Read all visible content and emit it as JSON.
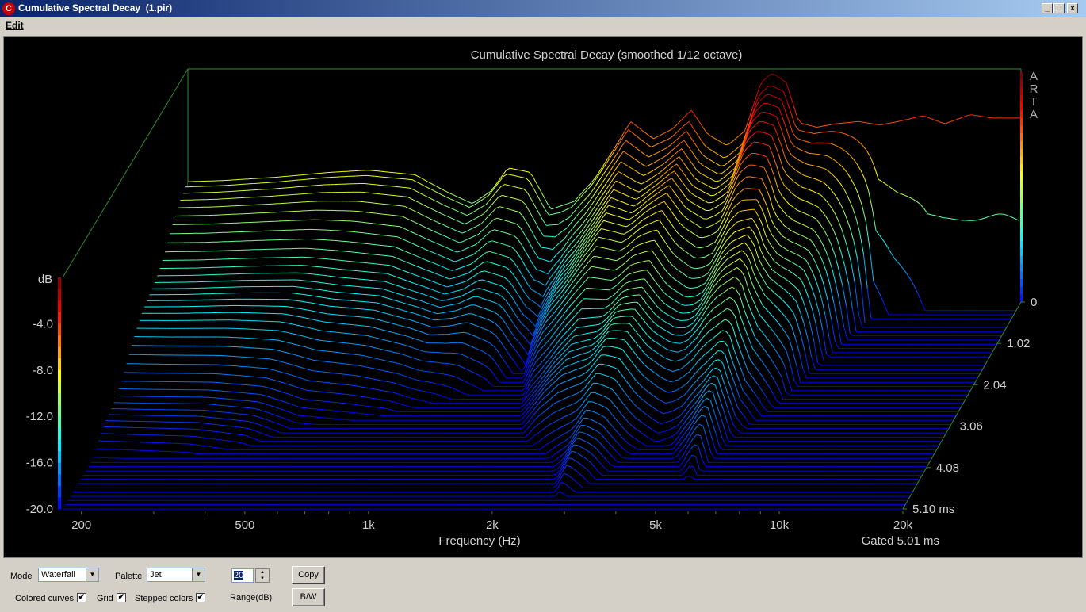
{
  "window": {
    "title": "Cumulative Spectral Decay  (1.pir)",
    "app_icon": "C",
    "min_glyph": "_",
    "max_glyph": "□",
    "close_glyph": "x"
  },
  "menu": {
    "edit": "Edit"
  },
  "chart_data": {
    "type": "waterfall",
    "title": "Cumulative Spectral Decay (smoothed 1/12 octave)",
    "watermark": [
      "A",
      "R",
      "T",
      "A"
    ],
    "xlabel": "Frequency (Hz)",
    "x_ticks": [
      {
        "label": "200",
        "value": 200
      },
      {
        "label": "500",
        "value": 500
      },
      {
        "label": "1k",
        "value": 1000
      },
      {
        "label": "2k",
        "value": 2000
      },
      {
        "label": "5k",
        "value": 5000
      },
      {
        "label": "10k",
        "value": 10000
      },
      {
        "label": "20k",
        "value": 20000
      }
    ],
    "xlim": [
      180,
      20000
    ],
    "x_scale": "log",
    "zlabel": "dB",
    "z_ticks": [
      "-4.0",
      "-8.0",
      "-12.0",
      "-16.0",
      "-20.0"
    ],
    "zlim": [
      -20,
      0
    ],
    "time_ticks": [
      "0",
      "1.02",
      "2.04",
      "3.06",
      "4.08",
      "5.10 ms"
    ],
    "time_range_ms": [
      0,
      5.1
    ],
    "slices": 50,
    "gated_label": "Gated 5.01 ms",
    "palette": "Jet",
    "frequency_response_db": [
      [
        180,
        -9.6
      ],
      [
        220,
        -9.5
      ],
      [
        300,
        -9.2
      ],
      [
        400,
        -8.8
      ],
      [
        500,
        -8.6
      ],
      [
        650,
        -9.0
      ],
      [
        780,
        -10.5
      ],
      [
        900,
        -11.5
      ],
      [
        1000,
        -10.4
      ],
      [
        1100,
        -8.4
      ],
      [
        1250,
        -8.8
      ],
      [
        1400,
        -12.0
      ],
      [
        1600,
        -11.3
      ],
      [
        1800,
        -9.3
      ],
      [
        2000,
        -6.8
      ],
      [
        2200,
        -4.4
      ],
      [
        2500,
        -5.9
      ],
      [
        2800,
        -5.0
      ],
      [
        3100,
        -3.4
      ],
      [
        3400,
        -5.5
      ],
      [
        3800,
        -6.5
      ],
      [
        4200,
        -5.2
      ],
      [
        4600,
        -1.0
      ],
      [
        4900,
        -0.2
      ],
      [
        5300,
        -1.0
      ],
      [
        5700,
        -4.5
      ],
      [
        6300,
        -4.9
      ],
      [
        7000,
        -4.6
      ],
      [
        8000,
        -4.4
      ],
      [
        9000,
        -4.7
      ],
      [
        10000,
        -4.4
      ],
      [
        11500,
        -3.9
      ],
      [
        13000,
        -4.6
      ],
      [
        15000,
        -3.8
      ],
      [
        17000,
        -4.1
      ],
      [
        20000,
        -4.1
      ]
    ],
    "decay_ms_at_minus20db": [
      [
        180,
        3.8
      ],
      [
        300,
        3.7
      ],
      [
        400,
        3.5
      ],
      [
        500,
        3.1
      ],
      [
        800,
        2.9
      ],
      [
        1000,
        2.6
      ],
      [
        1300,
        2.2
      ],
      [
        1500,
        1.5
      ],
      [
        1700,
        2.7
      ],
      [
        2000,
        3.5
      ],
      [
        2300,
        3.9
      ],
      [
        2600,
        4.3
      ],
      [
        2800,
        4.9
      ],
      [
        3100,
        4.5
      ],
      [
        3500,
        3.9
      ],
      [
        4000,
        3.5
      ],
      [
        4500,
        3.6
      ],
      [
        5000,
        4.0
      ],
      [
        5500,
        4.6
      ],
      [
        6000,
        3.4
      ],
      [
        7000,
        2.6
      ],
      [
        8000,
        1.3
      ],
      [
        9000,
        0.4
      ],
      [
        10000,
        0.3
      ],
      [
        12000,
        0.2
      ],
      [
        14000,
        0.2
      ],
      [
        17000,
        0.2
      ],
      [
        20000,
        0.2
      ]
    ]
  },
  "controls": {
    "mode_label": "Mode",
    "mode_value": "Waterfall",
    "palette_label": "Palette",
    "palette_value": "Jet",
    "range_value": "20",
    "range_label": "Range(dB)",
    "copy_label": "Copy",
    "bw_label": "B/W",
    "colored_curves_label": "Colored curves",
    "colored_curves_checked": true,
    "grid_label": "Grid",
    "grid_checked": true,
    "stepped_colors_label": "Stepped colors",
    "stepped_colors_checked": true,
    "check_glyph": "✔"
  }
}
